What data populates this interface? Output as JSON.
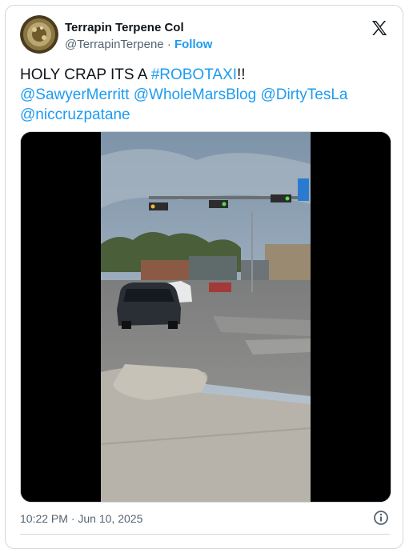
{
  "author": {
    "name": "Terrapin Terpene Col",
    "handle": "@TerrapinTerpene",
    "separator": "·",
    "follow_label": "Follow"
  },
  "tweet": {
    "line1_prefix": "HOLY CRAP ITS A ",
    "line1_hashtag": "#ROBOTAXI",
    "line1_suffix": "!!",
    "mentions": [
      "@SawyerMerritt",
      "@WholeMarsBlog",
      "@DirtyTesLa",
      "@niccruzpatane"
    ]
  },
  "meta": {
    "time": "10:22 PM",
    "separator": "·",
    "date": "Jun 10, 2025"
  },
  "icons": {
    "platform": "x-logo-icon",
    "info": "info-icon"
  },
  "colors": {
    "link": "#1d9bf0",
    "secondary_text": "#536471",
    "border": "#cfd9de"
  }
}
